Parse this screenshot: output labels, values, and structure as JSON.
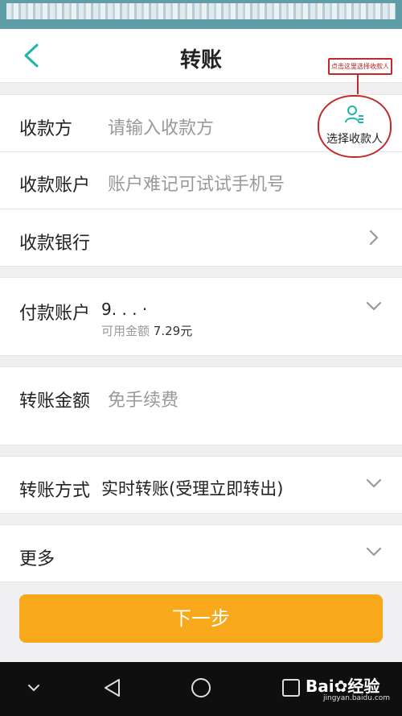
{
  "header": {
    "title": "转账",
    "annotation": "点击这里选择收款人"
  },
  "payee": {
    "label": "收款方",
    "placeholder": "请输入收款方",
    "select_label": "选择收款人"
  },
  "account": {
    "label": "收款账户",
    "placeholder": "账户难记可试试手机号"
  },
  "bank": {
    "label": "收款银行"
  },
  "payment": {
    "label": "付款账户",
    "number": "9. . . ·",
    "available_label": "可用金额",
    "available_amount": "7.29元"
  },
  "amount": {
    "label": "转账金额",
    "placeholder": "免手续费"
  },
  "method": {
    "label": "转账方式",
    "value": "实时转账(受理立即转出)"
  },
  "more": {
    "label": "更多"
  },
  "next_button": {
    "label": "下一步"
  },
  "watermark": {
    "brand": "Bai",
    "suffix": "经验",
    "site": "jingyan.baidu.com"
  },
  "colors": {
    "accent": "#1fb5a8",
    "button": "#f7a81b",
    "annotation": "#c62828"
  },
  "icons": [
    "back-arrow-icon",
    "person-list-icon",
    "chevron-right-icon",
    "chevron-down-icon",
    "nav-down-icon",
    "nav-back-icon",
    "nav-home-icon",
    "nav-recent-icon",
    "paw-icon"
  ]
}
